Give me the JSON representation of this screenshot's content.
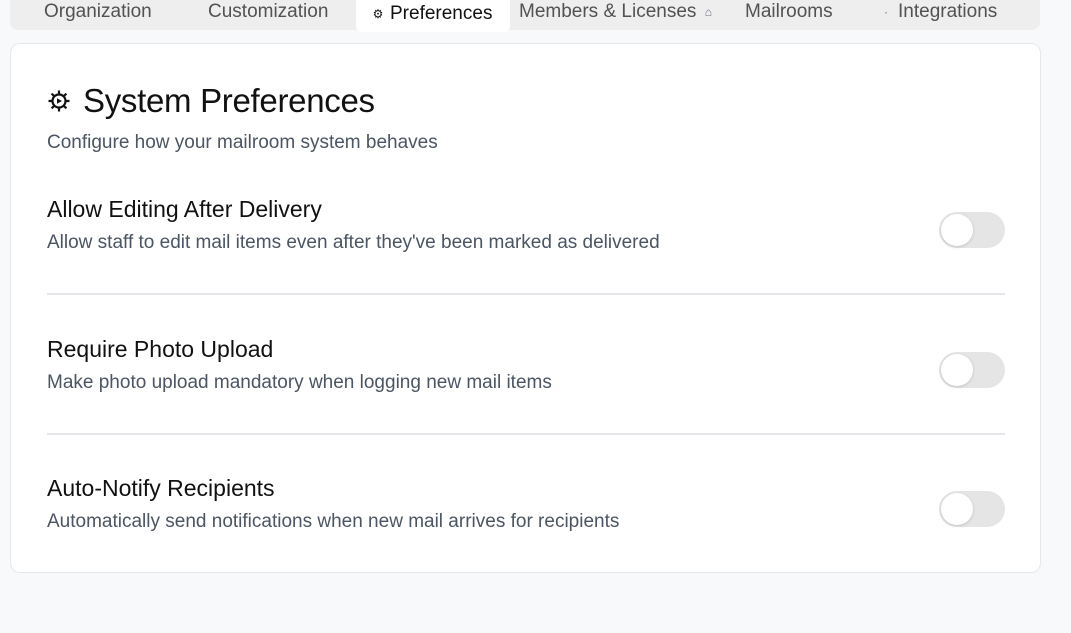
{
  "tabs": [
    {
      "label": "Organization",
      "icon": "building-icon",
      "active": false
    },
    {
      "label": "Customization",
      "icon": "palette-icon",
      "active": false
    },
    {
      "label": "Preferences",
      "icon": "gear-icon",
      "active": true
    },
    {
      "label": "Members & Licenses",
      "icon": "users-icon",
      "active": false
    },
    {
      "label": "Mailrooms",
      "icon": "box-icon",
      "active": false
    },
    {
      "label": "Integrations",
      "icon": "plug-icon",
      "active": false
    }
  ],
  "header": {
    "title": "System Preferences",
    "subtitle": "Configure how your mailroom system behaves"
  },
  "settings": [
    {
      "title": "Allow Editing After Delivery",
      "description": "Allow staff to edit mail items even after they've been marked as delivered",
      "enabled": false
    },
    {
      "title": "Require Photo Upload",
      "description": "Make photo upload mandatory when logging new mail items",
      "enabled": false
    },
    {
      "title": "Auto-Notify Recipients",
      "description": "Automatically send notifications when new mail arrives for recipients",
      "enabled": false
    }
  ],
  "colors": {
    "page_bg": "#f8f9fa",
    "card_bg": "#ffffff",
    "toggle_off": "#e5e5e5",
    "muted_text": "#4b5563"
  }
}
